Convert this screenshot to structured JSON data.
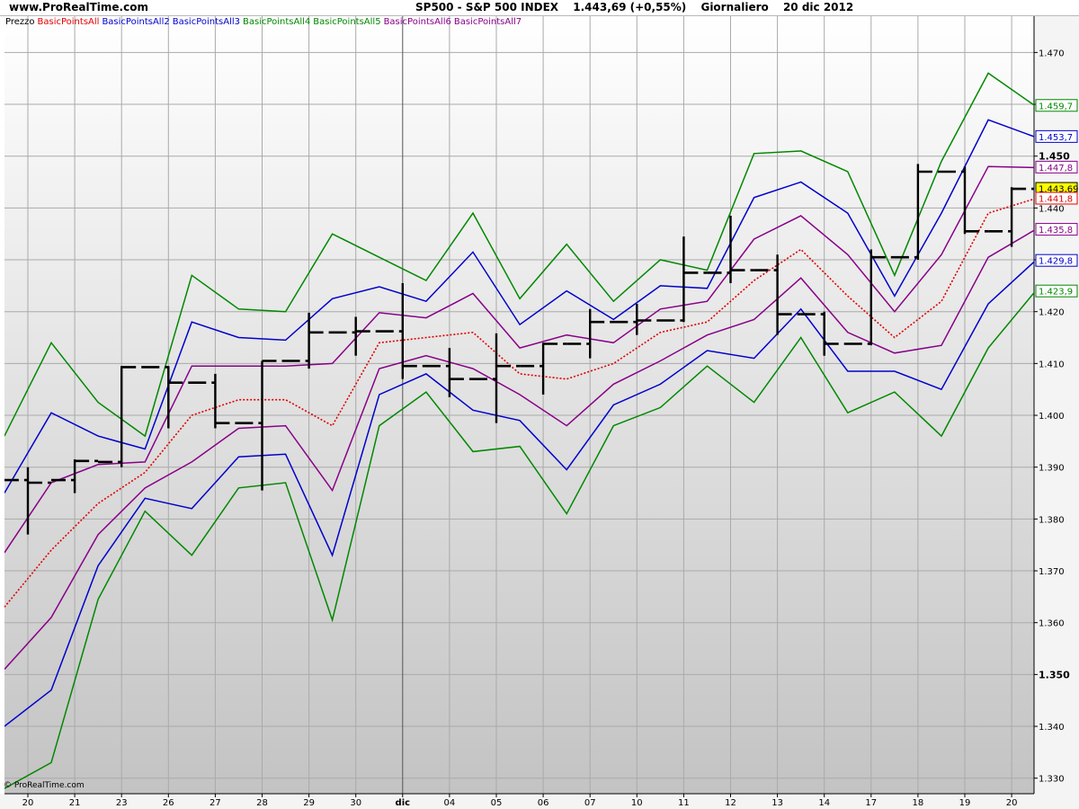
{
  "header": {
    "site": "www.ProRealTime.com",
    "instrument": "SP500 - S&P 500 INDEX",
    "last": "1.443,69 (+0,55%)",
    "period": "Giornaliero",
    "date": "20 dic 2012"
  },
  "legend": {
    "price": "Prezzo",
    "items": [
      {
        "label": "BasicPointsAll",
        "color": "#e00000"
      },
      {
        "label": "BasicPointsAll2",
        "color": "#0000cc"
      },
      {
        "label": "BasicPointsAll3",
        "color": "#0000cc"
      },
      {
        "label": "BasicPointsAll4",
        "color": "#008800"
      },
      {
        "label": "BasicPointsAll5",
        "color": "#008800"
      },
      {
        "label": "BasicPointsAll6",
        "color": "#880088"
      },
      {
        "label": "BasicPointsAll7",
        "color": "#880088"
      }
    ]
  },
  "watermark": "© ProRealTime.com",
  "chart_data": {
    "type": "line",
    "x": [
      "20",
      "21",
      "23",
      "26",
      "27",
      "28",
      "29",
      "30",
      "dic",
      "04",
      "05",
      "06",
      "07",
      "10",
      "11",
      "12",
      "13",
      "14",
      "17",
      "18",
      "19",
      "20"
    ],
    "month_label_index": 8,
    "ylim": [
      1327,
      1477
    ],
    "y_ticks": [
      1330,
      1340,
      1350,
      1360,
      1370,
      1380,
      1390,
      1400,
      1410,
      1420,
      1430,
      1440,
      1450,
      1460,
      1470
    ],
    "y_major": [
      1350,
      1450
    ],
    "y_tick_labels": [
      "1.330",
      "1.340",
      "1.350",
      "1.360",
      "1.370",
      "1.380",
      "1.390",
      "1.400",
      "1.410",
      "1.420",
      "1.430",
      "1.440",
      "1.450",
      "1.460",
      "1.470"
    ],
    "grid": true,
    "price": {
      "name": "Prezzo",
      "color": "#000000",
      "ohlc": [
        [
          1387.5,
          1390.0,
          1377.0,
          1387.0
        ],
        [
          1387.5,
          1391.5,
          1385.0,
          1391.2
        ],
        [
          1391.0,
          1409.5,
          1390.0,
          1409.3
        ],
        [
          1409.3,
          1409.5,
          1397.5,
          1406.3
        ],
        [
          1406.3,
          1408.0,
          1397.5,
          1398.5
        ],
        [
          1398.5,
          1410.5,
          1385.5,
          1410.5
        ],
        [
          1410.5,
          1419.8,
          1409.0,
          1416.0
        ],
        [
          1416.0,
          1419.0,
          1411.5,
          1416.2
        ],
        [
          1416.2,
          1425.5,
          1407.0,
          1409.5
        ],
        [
          1409.5,
          1413.0,
          1403.5,
          1407.0
        ],
        [
          1407.0,
          1415.8,
          1398.5,
          1409.5
        ],
        [
          1409.5,
          1414.0,
          1404.0,
          1413.8
        ],
        [
          1413.8,
          1420.5,
          1411.0,
          1418.0
        ],
        [
          1418.0,
          1421.5,
          1415.5,
          1418.3
        ],
        [
          1418.3,
          1434.5,
          1418.0,
          1427.5
        ],
        [
          1427.5,
          1438.5,
          1425.5,
          1428.0
        ],
        [
          1428.0,
          1431.0,
          1415.5,
          1419.5
        ],
        [
          1419.5,
          1420.0,
          1411.5,
          1413.8
        ],
        [
          1413.8,
          1432.0,
          1413.5,
          1430.5
        ],
        [
          1430.5,
          1448.5,
          1430.0,
          1447.0
        ],
        [
          1447.0,
          1448.0,
          1435.0,
          1435.5
        ],
        [
          1435.5,
          1444.0,
          1432.5,
          1443.69
        ]
      ]
    },
    "series": [
      {
        "name": "BasicPointsAll",
        "color": "#e00000",
        "dash": "dotted",
        "values": [
          1363,
          1374,
          1383,
          1389,
          1400,
          1403,
          1403,
          1398,
          1414,
          1415,
          1416,
          1408,
          1407,
          1410,
          1416,
          1418,
          1426,
          1432,
          1423,
          1415,
          1422,
          1439,
          1441.8
        ]
      },
      {
        "name": "BasicPointsAll2",
        "color": "#0000cc",
        "values": [
          1385,
          1400.5,
          1396,
          1393.5,
          1418,
          1415,
          1414.5,
          1422.5,
          1424.8,
          1422,
          1431.5,
          1417.5,
          1424,
          1418.5,
          1425,
          1424.5,
          1442,
          1445,
          1439,
          1423,
          1439,
          1457,
          1453.7
        ]
      },
      {
        "name": "BasicPointsAll3",
        "color": "#0000cc",
        "values": [
          1340,
          1347,
          1371,
          1384,
          1382,
          1392,
          1392.5,
          1373,
          1404,
          1408,
          1401,
          1399,
          1389.5,
          1402,
          1406,
          1412.5,
          1411,
          1420.5,
          1408.5,
          1408.5,
          1405,
          1421.5,
          1429.8
        ]
      },
      {
        "name": "BasicPointsAll4",
        "color": "#008800",
        "values": [
          1396,
          1414,
          1402.5,
          1396,
          1427,
          1420.5,
          1420,
          1435,
          1430.5,
          1426,
          1439,
          1422.5,
          1433,
          1422,
          1430,
          1428,
          1450.5,
          1451,
          1447,
          1427,
          1449,
          1466,
          1459.7
        ]
      },
      {
        "name": "BasicPointsAll5",
        "color": "#008800",
        "values": [
          1328,
          1333,
          1364.5,
          1381.5,
          1373,
          1386,
          1387,
          1360.5,
          1398,
          1404.5,
          1393,
          1394,
          1381,
          1398,
          1401.5,
          1409.5,
          1402.5,
          1415,
          1400.5,
          1404.5,
          1396,
          1413,
          1423.9
        ]
      },
      {
        "name": "BasicPointsAll6",
        "color": "#880088",
        "values": [
          1373.5,
          1387,
          1390.5,
          1391,
          1409.5,
          1409.5,
          1409.5,
          1410,
          1419.8,
          1418.8,
          1423.5,
          1413,
          1415.5,
          1414,
          1420.5,
          1422,
          1434,
          1438.5,
          1431,
          1420,
          1431,
          1448,
          1447.8
        ]
      },
      {
        "name": "BasicPointsAll7",
        "color": "#880088",
        "values": [
          1351,
          1361,
          1377,
          1386,
          1391,
          1397.5,
          1398,
          1385.5,
          1409,
          1411.5,
          1409,
          1404,
          1398,
          1406,
          1410.5,
          1415.5,
          1418.5,
          1426.5,
          1416,
          1412,
          1413.5,
          1430.5,
          1435.8
        ]
      }
    ],
    "last_values": [
      {
        "label": "1.459,7",
        "color": "#008800",
        "y": 1459.7
      },
      {
        "label": "1.453,7",
        "color": "#0000cc",
        "y": 1453.7
      },
      {
        "label": "1.447,8",
        "color": "#880088",
        "y": 1447.8
      },
      {
        "label": "1.443,69",
        "color": "#000000",
        "y": 1443.69,
        "bg": "#ffff00"
      },
      {
        "label": "1.441,8",
        "color": "#e00000",
        "y": 1441.8
      },
      {
        "label": "1.435,8",
        "color": "#880088",
        "y": 1435.8
      },
      {
        "label": "1.429,8",
        "color": "#0000cc",
        "y": 1429.8
      },
      {
        "label": "1.423,9",
        "color": "#008800",
        "y": 1423.9
      }
    ]
  }
}
